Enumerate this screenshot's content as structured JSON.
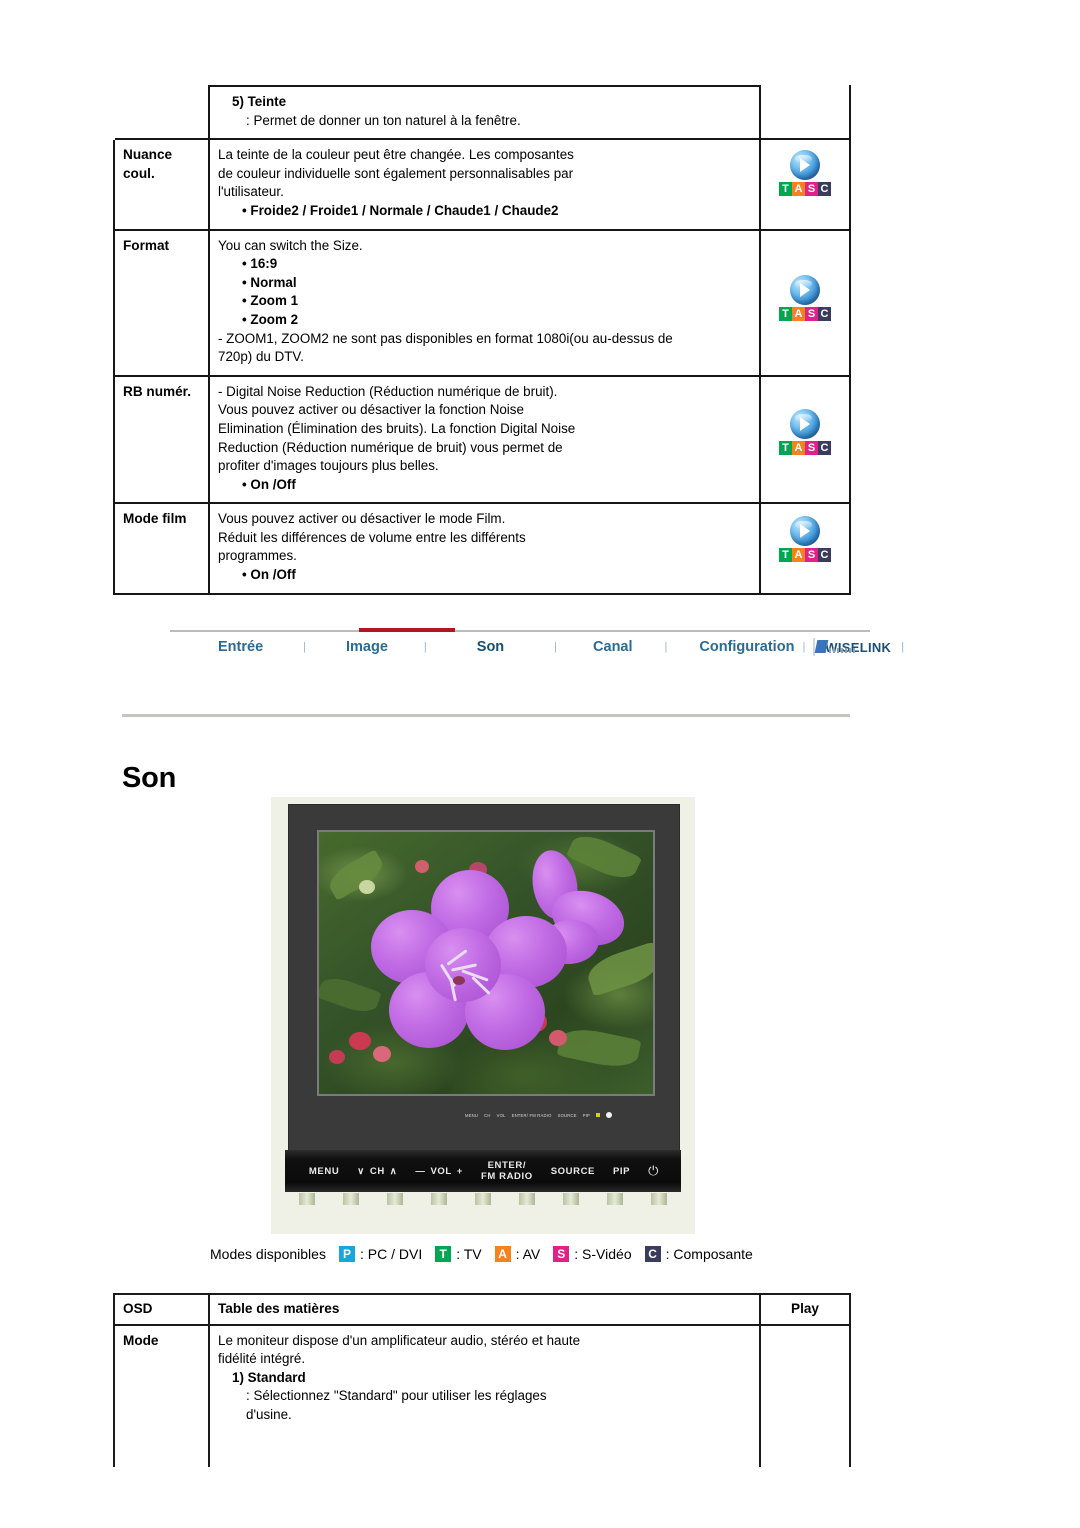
{
  "top_table": {
    "rows": [
      {
        "label": "",
        "heading": "5) Teinte",
        "subtext": ": Permet de donner un ton naturel à la fenêtre.",
        "body_lines": [],
        "bullets": [],
        "footnote": "",
        "icon": "none"
      },
      {
        "label": "Nuance coul.",
        "label_line1": "Nuance",
        "label_line2": "coul.",
        "heading": "",
        "body_lines": [
          "La teinte de la couleur peut être changée. Les composantes",
          "de couleur individuelle sont également personnalisables par",
          "l'utilisateur."
        ],
        "bullets": [
          "• Froide2 / Froide1 / Normale / Chaude1 / Chaude2"
        ],
        "footnote": "",
        "icon": "tasc-play-icon"
      },
      {
        "label": "Format",
        "heading": "",
        "body_lines": [
          "You can switch the Size."
        ],
        "bullets": [
          "• 16:9",
          "• Normal",
          "• Zoom 1",
          "• Zoom 2"
        ],
        "footnote_lines": [
          "- ZOOM1, ZOOM2 ne sont pas disponibles en format 1080i(ou au-dessus de",
          "720p) du DTV."
        ],
        "icon": "tasc-play-icon"
      },
      {
        "label": "RB numér.",
        "heading": "",
        "body_lines": [
          "- Digital Noise Reduction (Réduction numérique de bruit).",
          "Vous pouvez activer ou désactiver la fonction Noise",
          "Elimination (Élimination des bruits). La fonction Digital Noise",
          "Reduction (Réduction numérique de bruit) vous permet de",
          "profiter d'images toujours plus belles."
        ],
        "bullets": [
          "• On /Off"
        ],
        "footnote": "",
        "icon": "tasc-play-icon"
      },
      {
        "label": "Mode film",
        "heading": "",
        "body_lines": [
          "Vous pouvez activer ou désactiver le mode Film.",
          "Réduit les différences de volume entre les différents",
          "programmes."
        ],
        "bullets": [
          "• On /Off"
        ],
        "footnote": "",
        "icon": "tasc-play-icon"
      }
    ]
  },
  "tasc_icon": {
    "letters": [
      "T",
      "A",
      "S",
      "C"
    ],
    "colors": {
      "T": "#00a651",
      "A": "#f58220",
      "S": "#e0218a",
      "C": "#3b3b5c"
    },
    "ball_color": "#3c93d8"
  },
  "nav": {
    "items": [
      {
        "label": "Entrée",
        "active": false
      },
      {
        "label": "Image",
        "active": false
      },
      {
        "label": "Son",
        "active": true
      },
      {
        "label": "Canal",
        "active": false
      },
      {
        "label": "Configuration",
        "active": false
      },
      {
        "label": "WISELINK",
        "active": false
      }
    ],
    "separator": "|",
    "active_marker_color": "#b01722",
    "link_color": "#2a6b96"
  },
  "section": {
    "title": "Son"
  },
  "tv": {
    "mini_strip": {
      "items": [
        "MENU",
        "CH",
        "VOL",
        "ENTER/ FM RADIO",
        "SOURCE",
        "PIP"
      ]
    },
    "controls": [
      {
        "name": "menu",
        "label": "MENU"
      },
      {
        "name": "channel-down",
        "label": "∨"
      },
      {
        "name": "channel",
        "label": "CH"
      },
      {
        "name": "channel-up",
        "label": "∧"
      },
      {
        "name": "volume-down",
        "label": "—"
      },
      {
        "name": "volume",
        "label": "VOL"
      },
      {
        "name": "volume-up",
        "label": "+"
      },
      {
        "name": "enter-fm-radio-line1",
        "label": "ENTER/"
      },
      {
        "name": "enter-fm-radio-line2",
        "label": "FM RADIO"
      },
      {
        "name": "source",
        "label": "SOURCE"
      },
      {
        "name": "pip",
        "label": "PIP"
      },
      {
        "name": "power",
        "label": "⏻"
      }
    ],
    "screen_caption": "Purple tibouchina flower photo displayed on monitor screen"
  },
  "modes_legend": {
    "intro": "Modes disponibles",
    "entries": [
      {
        "badge": "P",
        "text": ": PC / DVI",
        "color": "#1ba5dd"
      },
      {
        "badge": "T",
        "text": ": TV",
        "color": "#00a651"
      },
      {
        "badge": "A",
        "text": ": AV",
        "color": "#f58220"
      },
      {
        "badge": "S",
        "text": ": S-Vidéo",
        "color": "#e0218a"
      },
      {
        "badge": "C",
        "text": ": Composante",
        "color": "#3b3b5c"
      }
    ]
  },
  "bottom_table": {
    "headers": {
      "osd": "OSD",
      "contents": "Table des matières",
      "play": "Play"
    },
    "rows": [
      {
        "label": "Mode",
        "body_lines": [
          "Le moniteur dispose d'un amplificateur audio, stéréo et haute",
          "fidélité intégré."
        ],
        "sub_heading": "1) Standard",
        "sub_text_lines": [
          ": Sélectionnez \"Standard\" pour utiliser les réglages",
          "d'usine."
        ]
      }
    ]
  }
}
